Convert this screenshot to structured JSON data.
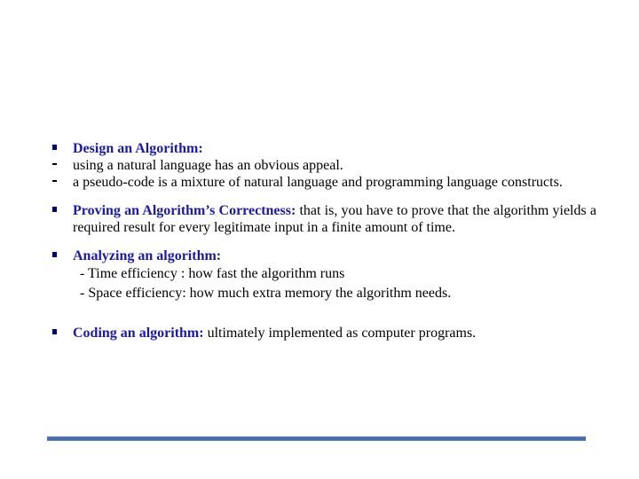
{
  "section1": {
    "heading": "Design an Algorithm:",
    "items": [
      "using a natural language has an obvious appeal.",
      "a pseudo-code is a mixture of natural language and programming language constructs."
    ]
  },
  "section2": {
    "heading": "Proving an Algorithm’s Correctness:",
    "text": " that is, you have to prove that the algorithm yields a required result for every legitimate input in a finite amount of time."
  },
  "section3": {
    "heading": "Analyzing an algorithm:",
    "items": [
      "- Time efficiency : how fast the algorithm runs",
      "- Space efficiency: how much extra memory the algorithm needs."
    ]
  },
  "section4": {
    "heading": "Coding an algorithm:",
    "text": " ultimately implemented as computer programs."
  },
  "colors": {
    "heading": "#1a1aa6",
    "bullet": "#000080",
    "rule": "#3f63a8"
  }
}
